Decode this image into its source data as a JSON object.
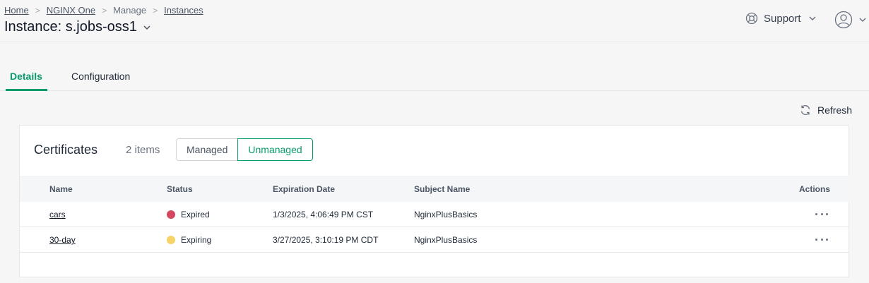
{
  "breadcrumb": {
    "home": "Home",
    "nginx_one": "NGINX One",
    "manage": "Manage",
    "instances": "Instances",
    "separator": ">"
  },
  "page": {
    "title": "Instance: s.jobs-oss1"
  },
  "header": {
    "support_label": "Support"
  },
  "tabs": [
    {
      "label": "Details",
      "active": true
    },
    {
      "label": "Configuration",
      "active": false
    }
  ],
  "toolbar": {
    "refresh_label": "Refresh"
  },
  "certificates": {
    "title": "Certificates",
    "count": "2 items",
    "filters": [
      {
        "label": "Managed",
        "selected": false
      },
      {
        "label": "Unmanaged",
        "selected": true
      }
    ],
    "columns": {
      "name": "Name",
      "status": "Status",
      "expiration": "Expiration Date",
      "subject": "Subject Name",
      "actions": "Actions"
    },
    "rows": [
      {
        "name": "cars",
        "status": "Expired",
        "status_color": "#d1485f",
        "expiration": "1/3/2025, 4:06:49 PM CST",
        "subject": "NginxPlusBasics"
      },
      {
        "name": "30-day",
        "status": "Expiring",
        "status_color": "#f7d266",
        "expiration": "3/27/2025, 3:10:19 PM CDT",
        "subject": "NginxPlusBasics"
      }
    ]
  },
  "colors": {
    "accent": "#0a9b6c",
    "background": "#f6f6f7"
  },
  "icons": {
    "support": "lifebuoy-icon",
    "user": "user-circle-icon",
    "refresh": "refresh-icon",
    "dropdown": "chevron-down-icon",
    "actions": "more-horizontal-icon"
  }
}
